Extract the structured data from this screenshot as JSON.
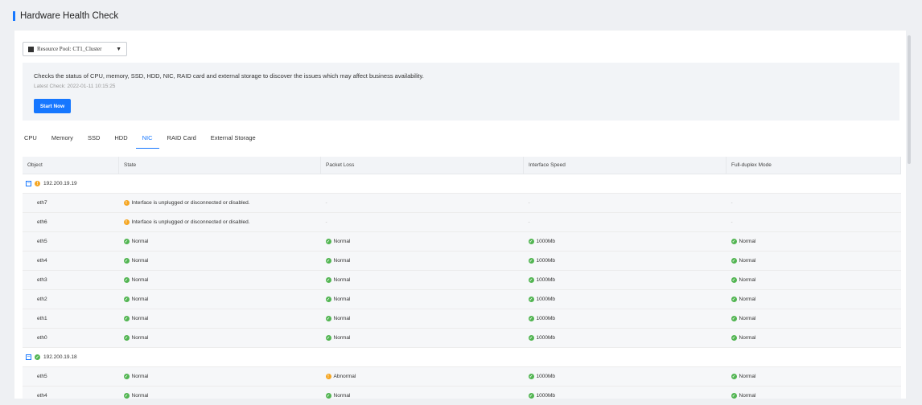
{
  "page": {
    "title": "Hardware Health Check"
  },
  "pool": {
    "label": "Resource Pool: CT1_Cluster"
  },
  "info": {
    "description": "Checks the status of CPU, memory, SSD, HDD, NIC, RAID card and external storage to discover the issues which may affect business availability.",
    "latest_check": "Latest Check: 2022-01-11 10:15:25",
    "start_label": "Start Now"
  },
  "tabs": [
    {
      "label": "CPU"
    },
    {
      "label": "Memory"
    },
    {
      "label": "SSD"
    },
    {
      "label": "HDD"
    },
    {
      "label": "NIC"
    },
    {
      "label": "RAID Card"
    },
    {
      "label": "External Storage"
    }
  ],
  "active_tab": "NIC",
  "columns": [
    "Object",
    "State",
    "Packet Loss",
    "Interface Speed",
    "Full-duplex Mode"
  ],
  "groups": [
    {
      "ip": "192.200.19.19",
      "status": "warning",
      "rows": [
        {
          "name": "eth7",
          "state": "Interface is unplugged or disconnected or disabled.",
          "state_status": "warning",
          "loss": "-",
          "loss_status": "none",
          "speed": "-",
          "speed_status": "none",
          "duplex": "-",
          "duplex_status": "none"
        },
        {
          "name": "eth6",
          "state": "Interface is unplugged or disconnected or disabled.",
          "state_status": "warning",
          "loss": "-",
          "loss_status": "none",
          "speed": "-",
          "speed_status": "none",
          "duplex": "-",
          "duplex_status": "none"
        },
        {
          "name": "eth5",
          "state": "Normal",
          "state_status": "ok",
          "loss": "Normal",
          "loss_status": "ok",
          "speed": "1000Mb",
          "speed_status": "ok",
          "duplex": "Normal",
          "duplex_status": "ok"
        },
        {
          "name": "eth4",
          "state": "Normal",
          "state_status": "ok",
          "loss": "Normal",
          "loss_status": "ok",
          "speed": "1000Mb",
          "speed_status": "ok",
          "duplex": "Normal",
          "duplex_status": "ok"
        },
        {
          "name": "eth3",
          "state": "Normal",
          "state_status": "ok",
          "loss": "Normal",
          "loss_status": "ok",
          "speed": "1000Mb",
          "speed_status": "ok",
          "duplex": "Normal",
          "duplex_status": "ok"
        },
        {
          "name": "eth2",
          "state": "Normal",
          "state_status": "ok",
          "loss": "Normal",
          "loss_status": "ok",
          "speed": "1000Mb",
          "speed_status": "ok",
          "duplex": "Normal",
          "duplex_status": "ok"
        },
        {
          "name": "eth1",
          "state": "Normal",
          "state_status": "ok",
          "loss": "Normal",
          "loss_status": "ok",
          "speed": "1000Mb",
          "speed_status": "ok",
          "duplex": "Normal",
          "duplex_status": "ok"
        },
        {
          "name": "eth0",
          "state": "Normal",
          "state_status": "ok",
          "loss": "Normal",
          "loss_status": "ok",
          "speed": "1000Mb",
          "speed_status": "ok",
          "duplex": "Normal",
          "duplex_status": "ok"
        }
      ]
    },
    {
      "ip": "192.200.19.18",
      "status": "ok",
      "rows": [
        {
          "name": "eth5",
          "state": "Normal",
          "state_status": "ok",
          "loss": "Abnormal",
          "loss_status": "warning",
          "speed": "1000Mb",
          "speed_status": "ok",
          "duplex": "Normal",
          "duplex_status": "ok"
        },
        {
          "name": "eth4",
          "state": "Normal",
          "state_status": "ok",
          "loss": "Normal",
          "loss_status": "ok",
          "speed": "1000Mb",
          "speed_status": "ok",
          "duplex": "Normal",
          "duplex_status": "ok"
        }
      ]
    }
  ]
}
